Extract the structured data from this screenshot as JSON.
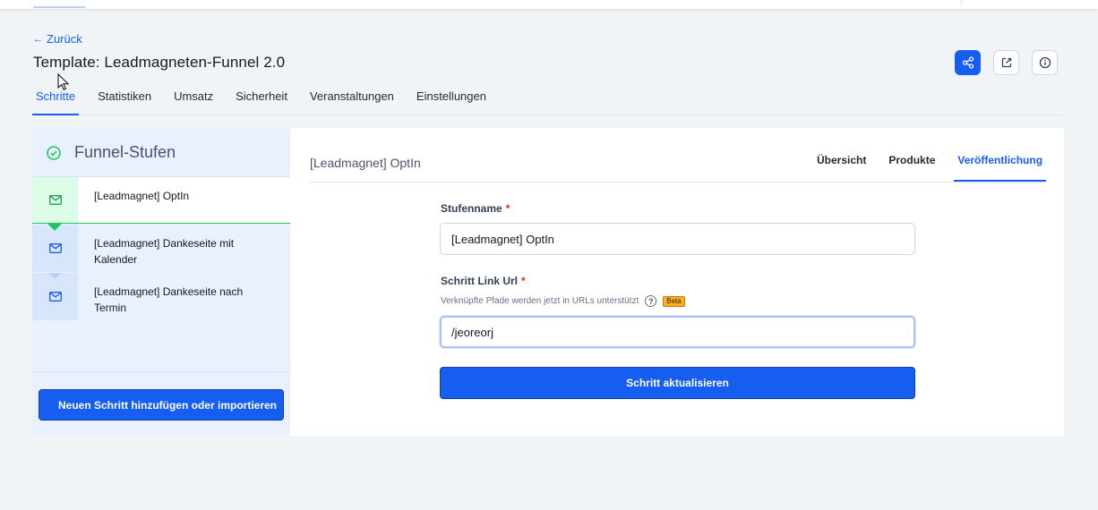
{
  "header": {
    "back_label": "Zurück",
    "title": "Template: Leadmagneten-Funnel 2.0"
  },
  "main_tabs": [
    {
      "label": "Schritte",
      "active": true
    },
    {
      "label": "Statistiken",
      "active": false
    },
    {
      "label": "Umsatz",
      "active": false
    },
    {
      "label": "Sicherheit",
      "active": false
    },
    {
      "label": "Veranstaltungen",
      "active": false
    },
    {
      "label": "Einstellungen",
      "active": false
    }
  ],
  "actions": {
    "share_icon": "share-icon",
    "open_icon": "external-link-icon",
    "info_icon": "info-icon"
  },
  "funnel": {
    "header": "Funnel-Stufen",
    "steps": [
      {
        "label": "[Leadmagnet] OptIn",
        "active": true
      },
      {
        "label": "[Leadmagnet] Dankeseite mit Kalender",
        "active": false
      },
      {
        "label": "[Leadmagnet] Dankeseite nach Termin",
        "active": false
      }
    ],
    "add_button": "Neuen Schritt hinzufügen oder importieren"
  },
  "detail": {
    "step_title": "[Leadmagnet] OptIn",
    "tabs": [
      {
        "label": "Übersicht",
        "active": false
      },
      {
        "label": "Produkte",
        "active": false
      },
      {
        "label": "Veröffentlichung",
        "active": true
      }
    ],
    "form": {
      "name_label": "Stufenname",
      "name_value": "[Leadmagnet] OptIn",
      "url_label": "Schritt Link Url",
      "url_hint": "Verknüpfte Pfade werden jetzt in URLs unterstützt",
      "help_glyph": "?",
      "beta_badge": "Beta",
      "url_value": "/jeoreorj",
      "required_mark": "*",
      "submit_label": "Schritt aktualisieren"
    }
  },
  "colors": {
    "primary": "#155eef",
    "success": "#22c55e",
    "panel_bg": "#e8f1fd"
  }
}
